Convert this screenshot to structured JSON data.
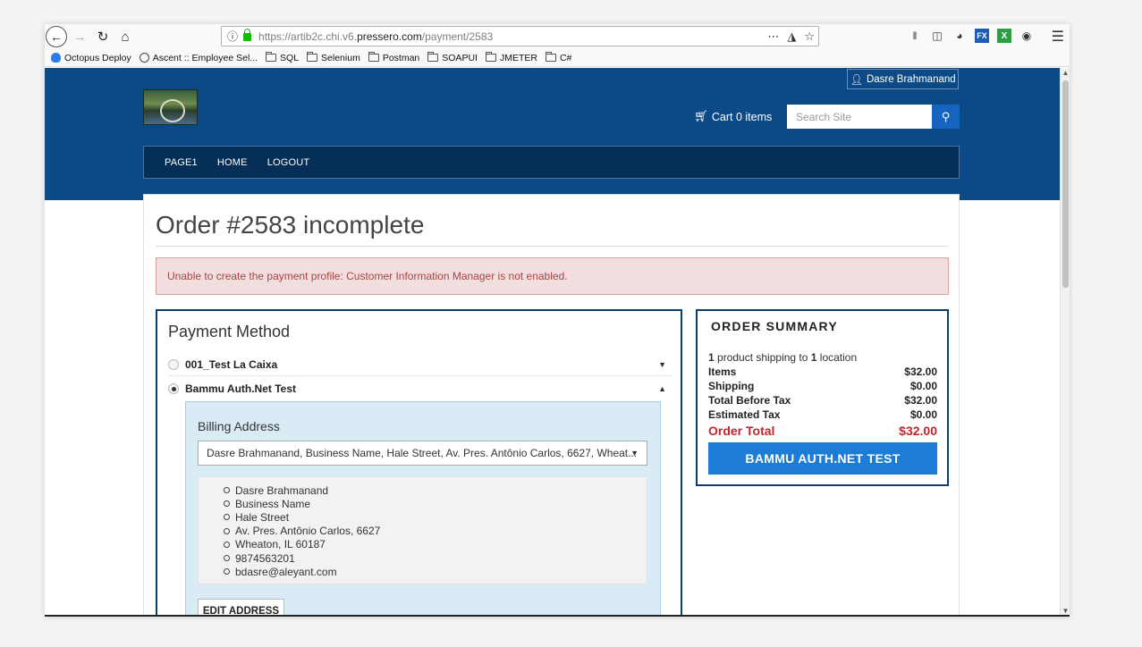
{
  "browser": {
    "url_prefix": "https://artib2c.chi.v6.",
    "url_domain": "pressero.com",
    "url_path": "/payment/2583",
    "tb_fx_label": "FX",
    "tb_x_label": "X"
  },
  "bookmarks": [
    {
      "label": "Octopus Deploy"
    },
    {
      "label": "Ascent :: Employee Sel..."
    },
    {
      "label": "SQL"
    },
    {
      "label": "Selenium"
    },
    {
      "label": "Postman"
    },
    {
      "label": "SOAPUI"
    },
    {
      "label": "JMETER"
    },
    {
      "label": "C#"
    }
  ],
  "header": {
    "user_name": "Dasre Brahmanand",
    "cart_label": "Cart 0 items",
    "search_placeholder": "Search Site",
    "nav": [
      {
        "label": "PAGE1"
      },
      {
        "label": "HOME"
      },
      {
        "label": "LOGOUT"
      }
    ]
  },
  "order": {
    "title": "Order #2583 incomplete",
    "alert": "Unable to create the payment profile: Customer Information Manager is not enabled."
  },
  "payment": {
    "title": "Payment Method",
    "methods": [
      {
        "label": "001_Test La Caixa",
        "selected": false
      },
      {
        "label": "Bammu Auth.Net Test",
        "selected": true
      }
    ],
    "billing_title": "Billing Address",
    "address_selected": "Dasre Brahmanand, Business Name, Hale Street, Av. Pres. Antônio Carlos, 6627, Wheat...",
    "address_lines": [
      "Dasre Brahmanand",
      "Business Name",
      "Hale Street",
      "Av. Pres. Antônio Carlos, 6627",
      "Wheaton, IL 60187",
      "9874563201",
      "bdasre@aleyant.com"
    ],
    "edit_label": "EDIT ADDRESS"
  },
  "summary": {
    "title": "ORDER SUMMARY",
    "ship_count": "1",
    "ship_mid": " product shipping to ",
    "ship_loc": "1",
    "ship_end": " location",
    "rows": [
      {
        "label": "Items",
        "value": "$32.00"
      },
      {
        "label": "Shipping",
        "value": "$0.00"
      },
      {
        "label": "Total Before Tax",
        "value": "$32.00"
      },
      {
        "label": "Estimated Tax",
        "value": "$0.00"
      }
    ],
    "total_label": "Order Total",
    "total_value": "$32.00",
    "pay_button": "BAMMU AUTH.NET TEST"
  },
  "colors": {
    "header_bg": "#0b4a86",
    "nav_bg": "#052f57",
    "alert_bg": "#f2dede",
    "alert_text": "#a94442",
    "total_red": "#c0262d",
    "pay_button": "#1c7cd6"
  }
}
